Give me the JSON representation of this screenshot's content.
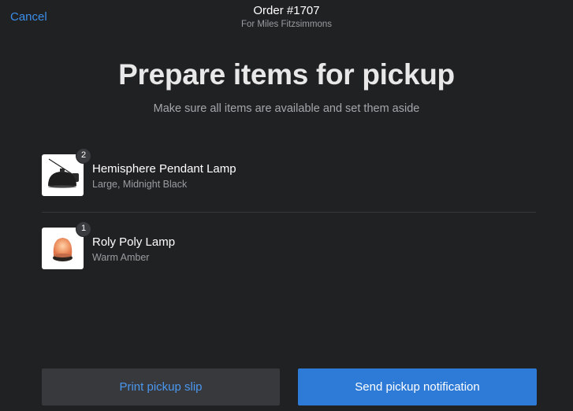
{
  "header": {
    "cancel_label": "Cancel",
    "order_title": "Order #1707",
    "order_subtitle": "For Miles Fitzsimmons"
  },
  "main": {
    "title": "Prepare items for pickup",
    "subtitle": "Make sure all items are available and set them aside"
  },
  "items": [
    {
      "name": "Hemisphere Pendant Lamp",
      "variant": "Large, Midnight Black",
      "quantity": "2",
      "icon": "pendant-lamp-image"
    },
    {
      "name": "Roly Poly Lamp",
      "variant": "Warm Amber",
      "quantity": "1",
      "icon": "roly-poly-lamp-image"
    }
  ],
  "actions": {
    "print_label": "Print pickup slip",
    "send_label": "Send pickup notification"
  },
  "colors": {
    "background": "#202123",
    "accent": "#2e7bd7",
    "link": "#3b8eea"
  }
}
